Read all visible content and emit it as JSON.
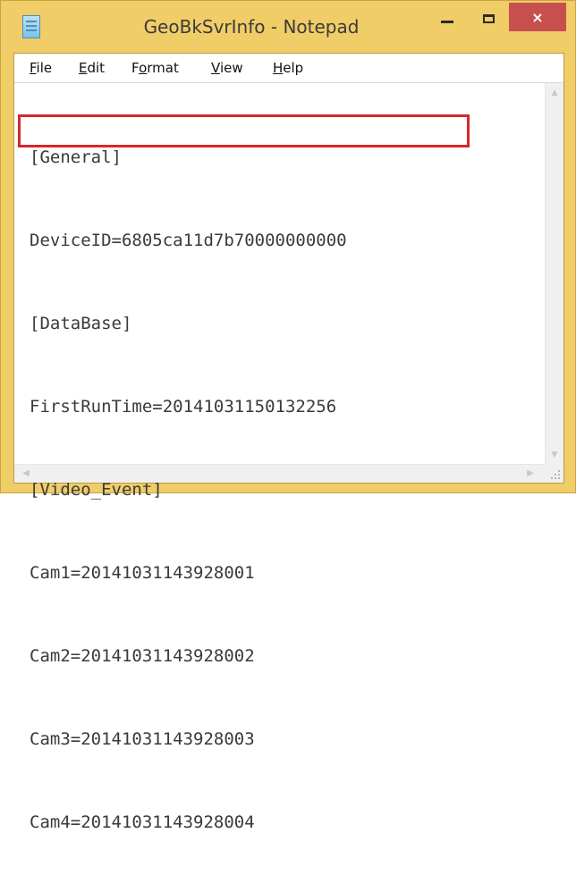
{
  "window": {
    "title": "GeoBkSvrInfo - Notepad",
    "controls": {
      "minimize_icon": "minimize-icon",
      "maximize_icon": "maximize-icon",
      "close_icon": "close-icon",
      "close_glyph": "×"
    },
    "accent_close": "#c7504e",
    "frame_color": "#f0cd66"
  },
  "menu": [
    {
      "label_rest": "ile",
      "mnemonic": "F"
    },
    {
      "label_rest": "dit",
      "mnemonic": "E"
    },
    {
      "label_pre": "F",
      "mnemonic": "o",
      "label_post": "rmat"
    },
    {
      "label_rest": "iew",
      "mnemonic": "V"
    },
    {
      "label_rest": "elp",
      "mnemonic": "H"
    }
  ],
  "document": {
    "lines": [
      "[General]",
      "DeviceID=6805ca11d7b70000000000",
      "[DataBase]",
      "FirstRunTime=20141031150132256",
      "[Video_Event]",
      "Cam1=20141031143928001",
      "Cam2=20141031143928002",
      "Cam3=20141031143928003",
      "Cam4=20141031143928004"
    ],
    "highlight_color": "#d8262b"
  },
  "scrollbars": {
    "up_glyph": "▲",
    "down_glyph": "▼",
    "left_glyph": "◀",
    "right_glyph": "▶"
  }
}
